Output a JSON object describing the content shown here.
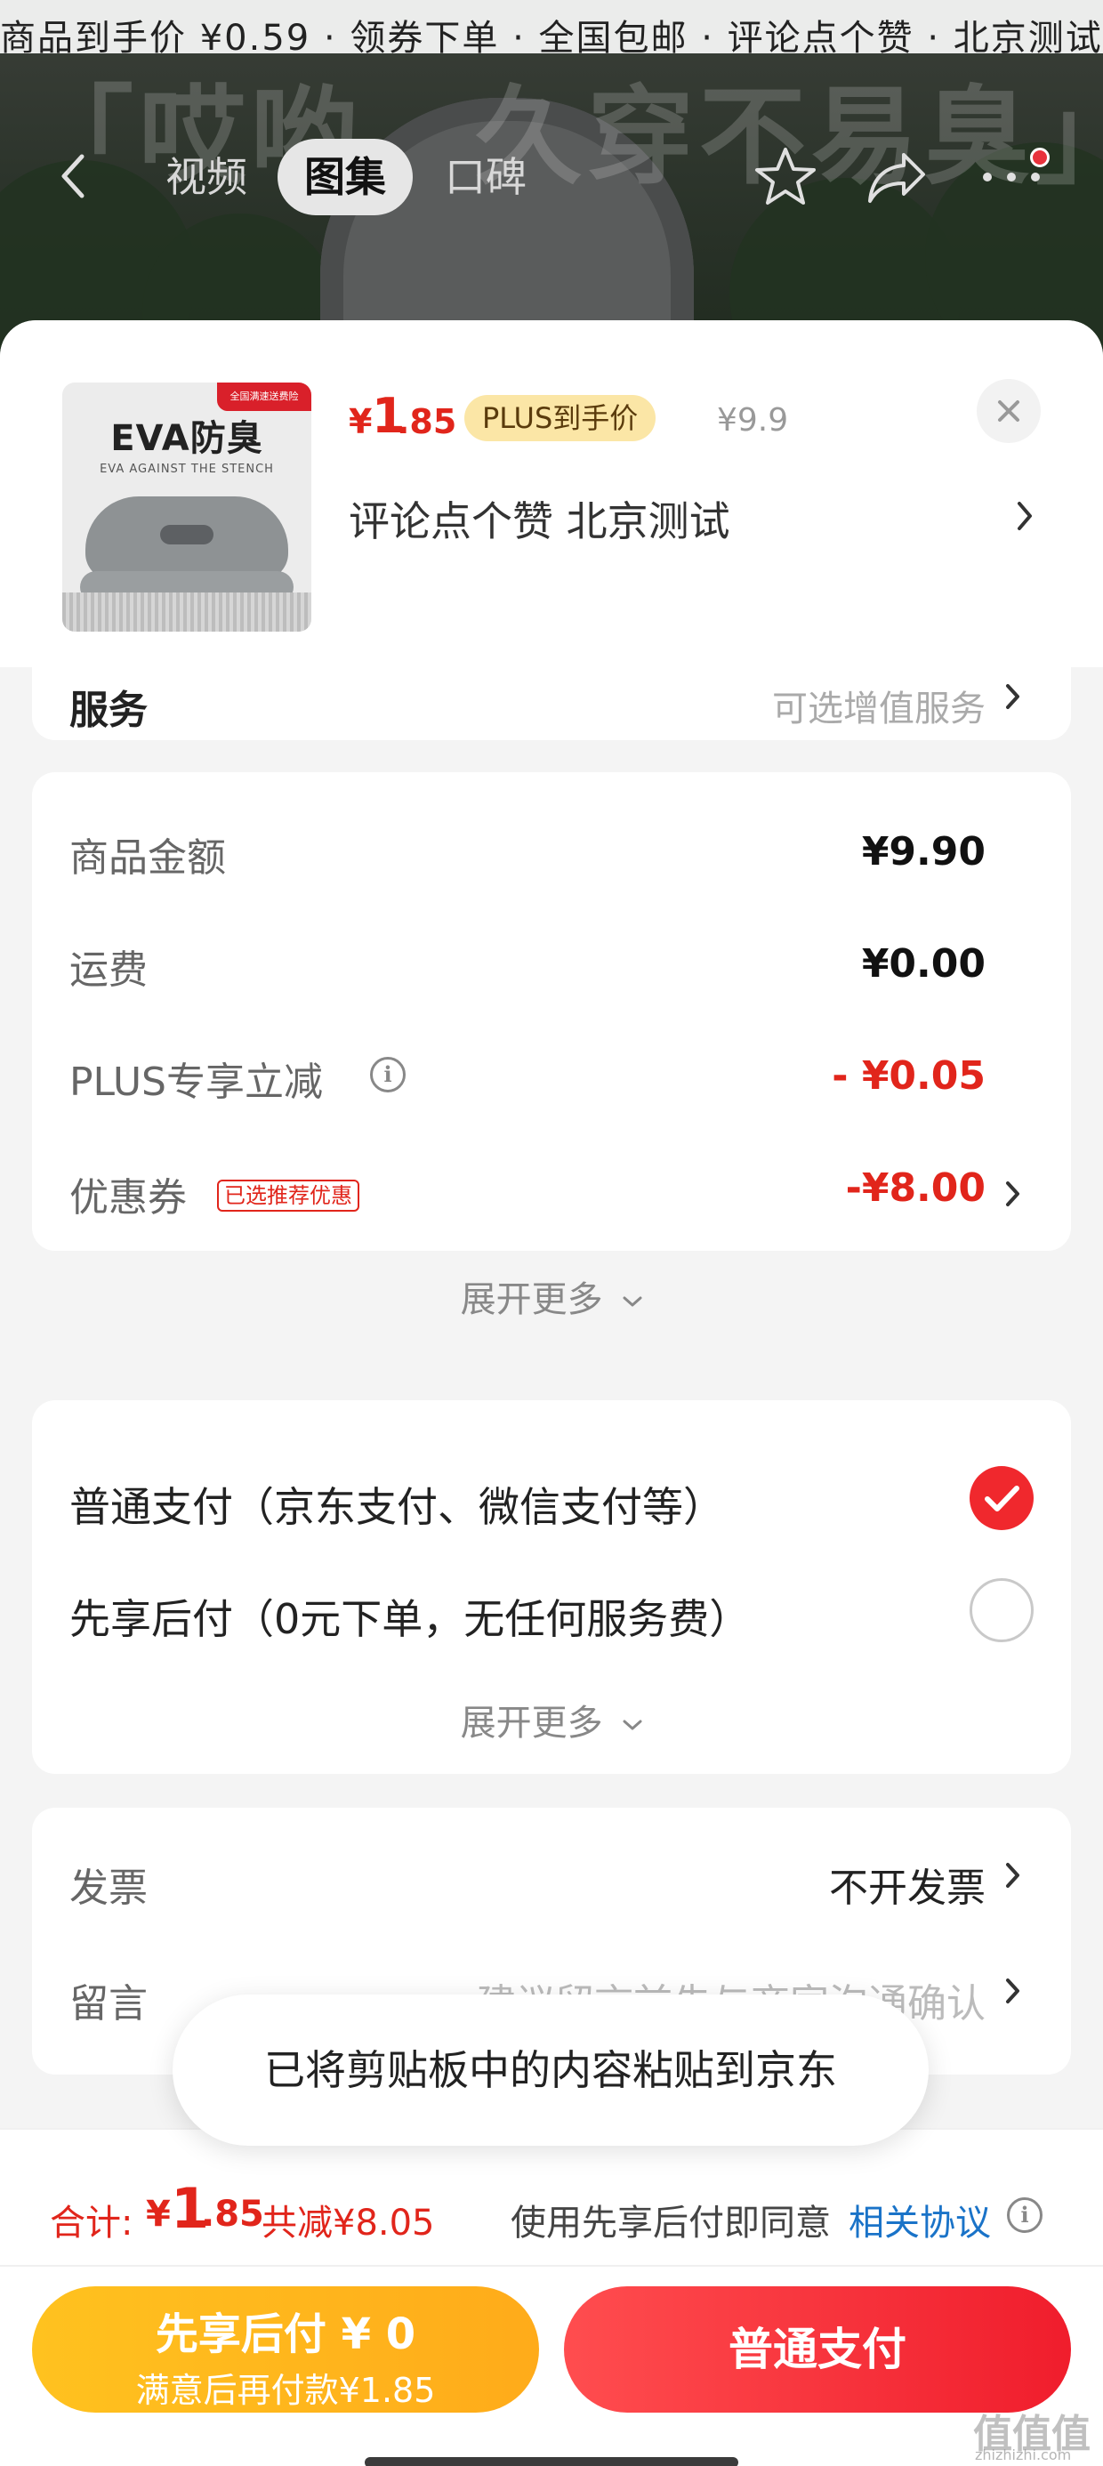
{
  "colors": {
    "accent_red": "#e1251b",
    "plus_gold": "#fbe6a6",
    "later_yellow": "#ffc21f",
    "link_blue": "#1a73c8"
  },
  "background": {
    "banner_text": "商品到手价 ¥0.59 · 领券下单 · 全国包邮 · 评论点个赞 · 北京测试 · 新品特惠 · 限时抢购",
    "slogan": "「哎哟，久穿不易臭」"
  },
  "nav": {
    "tabs": [
      {
        "label": "视频"
      },
      {
        "label": "图集"
      },
      {
        "label": "口碑"
      }
    ],
    "icons": [
      "back-icon",
      "star-icon",
      "share-icon",
      "more-icon"
    ]
  },
  "product": {
    "image": {
      "title": "EVA防臭",
      "subtitle": "EVA AGAINST THE STENCH",
      "ribbon": "全国满速送费险"
    },
    "price_currency": "¥",
    "price_int": "1",
    "price_dec": ".85",
    "plus_badge": "PLUS到手价",
    "original_price": "¥9.9",
    "name": "评论点个赞  北京测试"
  },
  "service": {
    "label": "服务",
    "value": "可选增值服务"
  },
  "price_details": {
    "rows": [
      {
        "label": "商品金额",
        "value": "¥9.90"
      },
      {
        "label": "运费",
        "value": "¥0.00"
      },
      {
        "label": "PLUS专享立减",
        "value": "- ¥0.05"
      },
      {
        "label": "优惠券",
        "value": "-¥8.00",
        "tag": "已选推荐优惠"
      }
    ],
    "expand_label": "展开更多"
  },
  "payment": {
    "options": [
      {
        "label": "普通支付（京东支付、微信支付等）",
        "selected": true
      },
      {
        "label": "先享后付（0元下单，无任何服务费）",
        "selected": false
      }
    ],
    "expand_label": "展开更多"
  },
  "invoice": {
    "invoice_label": "发票",
    "invoice_value": "不开发票",
    "note_label": "留言",
    "note_placeholder": "建议留言前先与商家沟通确认"
  },
  "toast": "已将剪贴板中的内容粘贴到京东",
  "bottom": {
    "total_label": "合计:",
    "total_currency": "¥",
    "total_int": "1",
    "total_dec": ".85",
    "total_reduce": "共减¥8.05",
    "agree_text": "使用先享后付即同意",
    "agree_link": "相关协议",
    "btn_later_main": "先享后付 ¥ 0",
    "btn_later_sub": "满意后再付款¥1.85",
    "btn_normal": "普通支付"
  },
  "watermark": {
    "logo": "值值值",
    "url": "zhizhizhi.com"
  }
}
